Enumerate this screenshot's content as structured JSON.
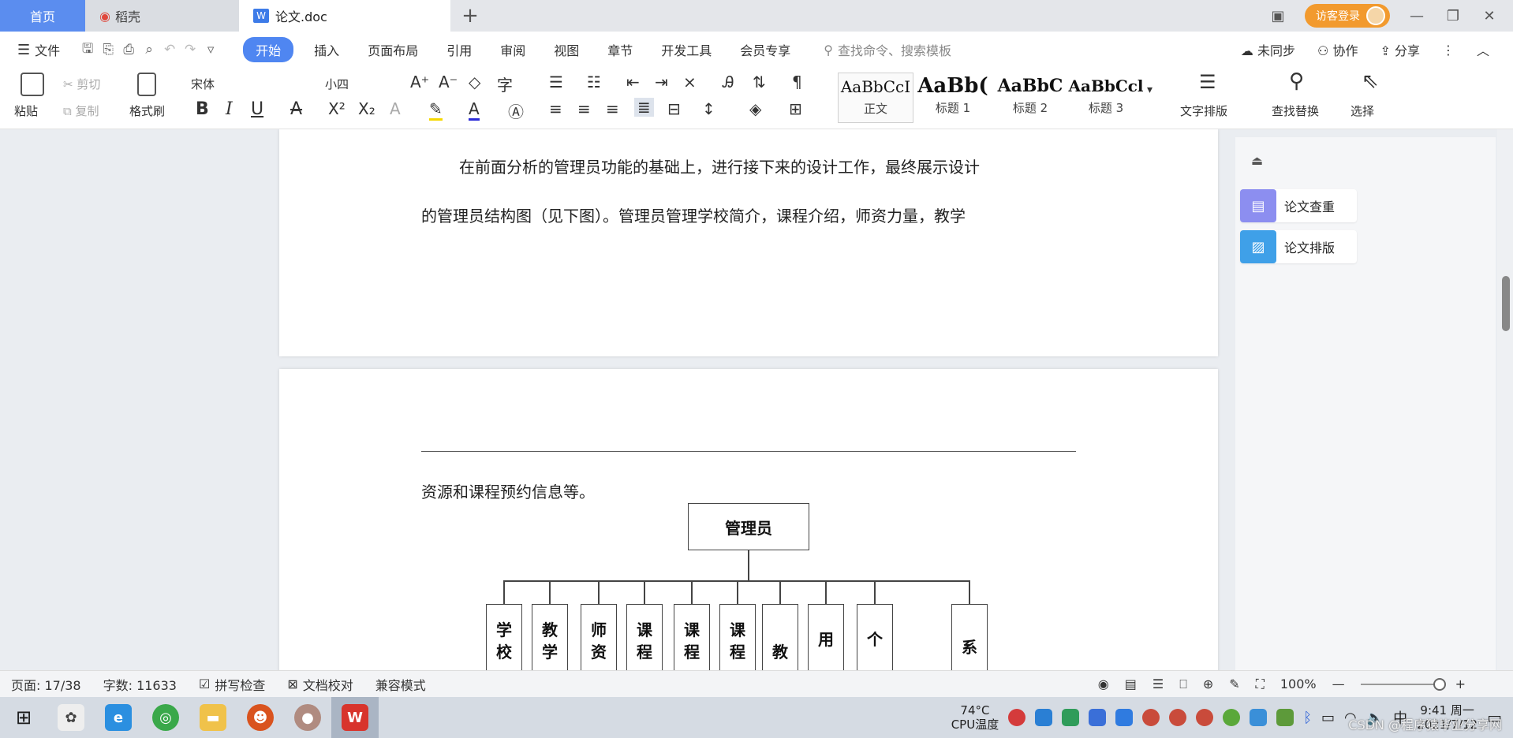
{
  "tabs": {
    "home": "首页",
    "daoke": "稻壳",
    "doc": "论文.doc",
    "add": "+"
  },
  "titlebar": {
    "login": "访客登录",
    "minimize": "—",
    "restore": "❐",
    "close": "✕"
  },
  "menu": {
    "file": "文件",
    "items": [
      "开始",
      "插入",
      "页面布局",
      "引用",
      "审阅",
      "视图",
      "章节",
      "开发工具",
      "会员专享"
    ],
    "search_placeholder": "查找命令、搜索模板",
    "sync": "未同步",
    "collab": "协作",
    "share": "分享"
  },
  "toolbar": {
    "paste": "粘贴",
    "cut": "剪切",
    "copy": "复制",
    "format_painter": "格式刷",
    "font_name": "宋体",
    "font_size": "小四",
    "styles": [
      {
        "sample": "AaBbCcI",
        "label": "正文"
      },
      {
        "sample": "AaBb(",
        "label": "标题 1"
      },
      {
        "sample": "AaBbC",
        "label": "标题 2"
      },
      {
        "sample": "AaBbCcl",
        "label": "标题 3"
      }
    ],
    "text_layout": "文字排版",
    "find_replace": "查找替换",
    "select": "选择"
  },
  "document": {
    "para1_line1": "在前面分析的管理员功能的基础上，进行接下来的设计工作，最终展示设计",
    "para1_line2": "的管理员结构图（见下图）。管理员管理学校简介，课程介绍，师资力量，教学",
    "para2_line1": "资源和课程预约信息等。",
    "org_root": "管理员",
    "org_children": [
      [
        "学",
        "校"
      ],
      [
        "教",
        "学"
      ],
      [
        "师",
        "资"
      ],
      [
        "课",
        "程"
      ],
      [
        "课",
        "程"
      ],
      [
        "课",
        "程"
      ],
      [
        "教",
        ""
      ],
      [
        "用",
        ""
      ],
      [
        "个",
        ""
      ],
      [
        "系",
        ""
      ]
    ]
  },
  "rightpane": {
    "check": "论文查重",
    "layout": "论文排版"
  },
  "status": {
    "page": "页面: 17/38",
    "words": "字数: 11633",
    "spellcheck": "拼写检查",
    "proofread": "文档校对",
    "compat": "兼容模式",
    "zoom": "100%"
  },
  "taskbar": {
    "temp": "74°C",
    "temp_label": "CPU温度",
    "ime": "中",
    "time": "9:41 周一",
    "date": "2021/7/12",
    "watermark": "CSDN @程序猿毕业分享网"
  }
}
